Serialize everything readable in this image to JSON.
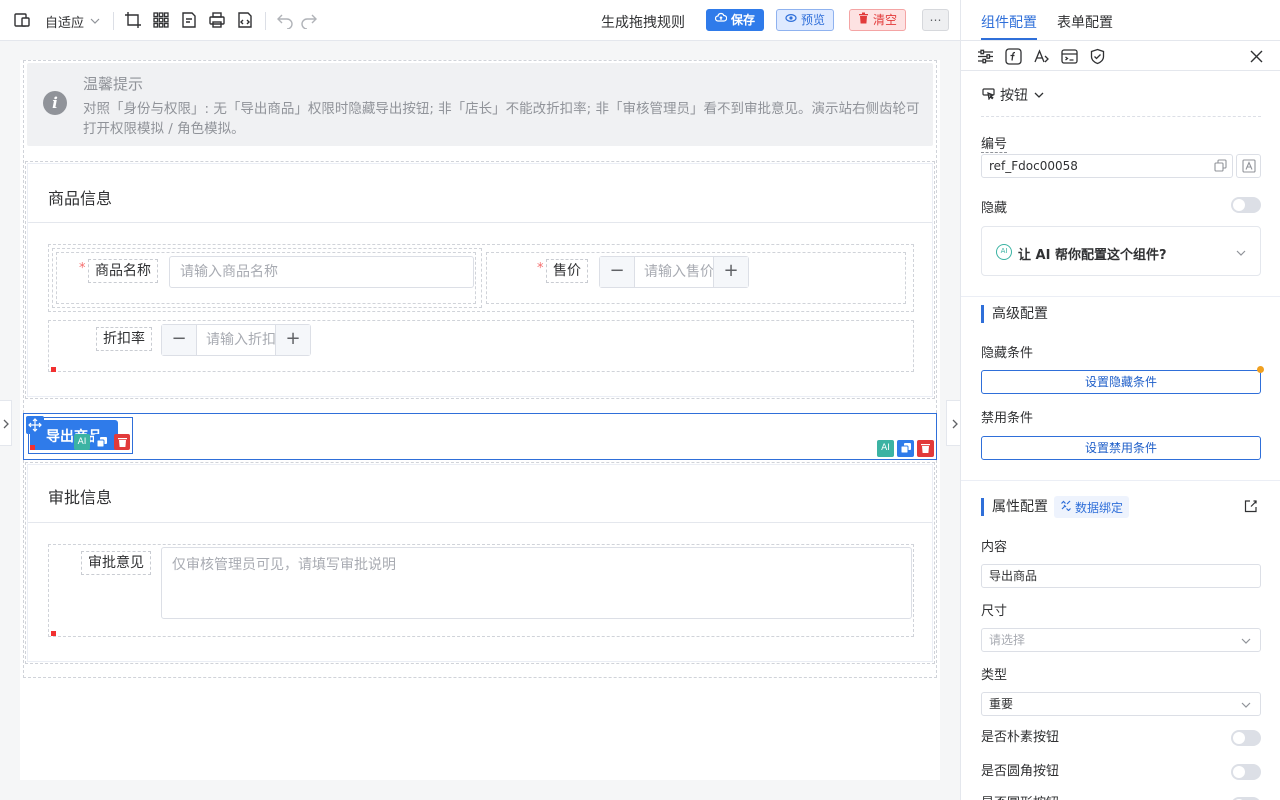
{
  "toolbar": {
    "fit_label": "自适应",
    "generate_rules": "生成拖拽规则",
    "save": "保存",
    "preview": "预览",
    "clear": "清空",
    "more": "⋯"
  },
  "canvas": {
    "tip": {
      "title": "温馨提示",
      "body": "对照「身份与权限」: 无「导出商品」权限时隐藏导出按钮; 非「店长」不能改折扣率; 非「审核管理员」看不到审批意见。演示站右侧齿轮可打开权限模拟 / 角色模拟。"
    },
    "product_section": {
      "title": "商品信息",
      "name_label": "商品名称",
      "name_placeholder": "请输入商品名称",
      "price_label": "售价",
      "price_placeholder": "请输入售价",
      "discount_label": "折扣率",
      "discount_placeholder": "请输入折扣率"
    },
    "export_button": "导出商品",
    "approval_section": {
      "title": "审批信息",
      "opinion_label": "审批意见",
      "opinion_placeholder": "仅审核管理员可见，请填写审批说明"
    },
    "mini_ai": "AI"
  },
  "panel": {
    "tabs": [
      "组件配置",
      "表单配置"
    ],
    "component_type": "按钮",
    "id_label": "编号",
    "id_value": "ref_Fdoc00058",
    "hidden_label": "隐藏",
    "ai_prompt": "让 AI 帮你配置这个组件?",
    "advanced_title": "高级配置",
    "hide_cond_label": "隐藏条件",
    "hide_cond_button": "设置隐藏条件",
    "disable_cond_label": "禁用条件",
    "disable_cond_button": "设置禁用条件",
    "props_title": "属性配置",
    "data_binding": "数据绑定",
    "content_label": "内容",
    "content_value": "导出商品",
    "size_label": "尺寸",
    "size_placeholder": "请选择",
    "type_label": "类型",
    "type_value": "重要",
    "plain_label": "是否朴素按钮",
    "round_label": "是否圆角按钮",
    "circle_label": "是否圆形按钮"
  },
  "colors": {
    "primary": "#2f6fd9",
    "danger": "#e23a3a",
    "accent_orange": "#f0a020"
  }
}
